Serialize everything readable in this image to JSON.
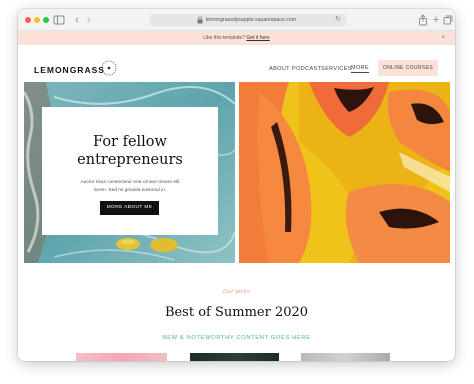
{
  "browser": {
    "url": "lemongrassdysapple.squarespace.com",
    "icons": [
      "sidebar-icon",
      "back-icon",
      "forward-icon",
      "lock-icon",
      "reload-icon",
      "share-icon",
      "new-tab-icon",
      "tabs-overview-icon"
    ]
  },
  "announcement": {
    "text": "Like this template?",
    "link": "Get it here",
    "close": "×"
  },
  "header": {
    "logo": "LEMONGRASS",
    "nav": [
      "ABOUT",
      "PODCAST",
      "SERVICES",
      "MORE"
    ],
    "cta": "ONLINE COURSES"
  },
  "hero": {
    "title_line1": "For fellow",
    "title_line2": "entrepreneurs",
    "body_line1": "Auctor risus consectetur erat ornare ornare elit",
    "body_line2": "lorem. Sed mi gravida euismod in.",
    "button": "MORE ABOUT ME"
  },
  "section": {
    "script": "Our picks",
    "title": "Best of Summer 2020",
    "subtitle": "NEW & NOTEWORTHY CONTENT GOES HERE"
  },
  "colors": {
    "announce_bg": "#fbe2d8",
    "accent_teal": "#4db0ad",
    "accent_coral": "#e8a08c",
    "button_black": "#111111"
  }
}
